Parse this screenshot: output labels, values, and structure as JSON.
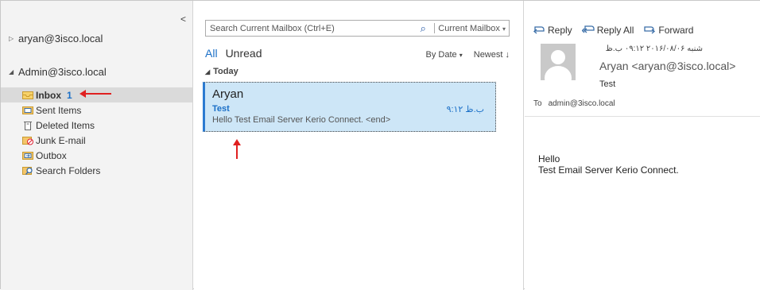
{
  "folder_pane": {
    "collapse_glyph": "<",
    "accounts": [
      {
        "name": "aryan@3isco.local",
        "expanded": false
      },
      {
        "name": "Admin@3isco.local",
        "expanded": true
      }
    ],
    "folders": [
      {
        "label": "Inbox",
        "count": "1",
        "icon": "inbox-icon",
        "selected": true
      },
      {
        "label": "Sent Items",
        "count": "",
        "icon": "sent-items-icon",
        "selected": false
      },
      {
        "label": "Deleted Items",
        "count": "",
        "icon": "trash-icon",
        "selected": false
      },
      {
        "label": "Junk E-mail",
        "count": "",
        "icon": "junk-mail-icon",
        "selected": false
      },
      {
        "label": "Outbox",
        "count": "",
        "icon": "outbox-icon",
        "selected": false
      },
      {
        "label": "Search Folders",
        "count": "",
        "icon": "search-folder-icon",
        "selected": false
      }
    ]
  },
  "message_list": {
    "search": {
      "placeholder": "Search Current Mailbox (Ctrl+E)",
      "scope": "Current Mailbox"
    },
    "filters": {
      "all": "All",
      "unread": "Unread",
      "sort_by": "By Date",
      "order": "Newest"
    },
    "group_label": "Today",
    "messages": [
      {
        "from": "Aryan",
        "subject": "Test",
        "time": "۹:۱۲ ب.ظ",
        "preview": "Hello  Test Email Server Kerio Connect. <end>"
      }
    ]
  },
  "reading_pane": {
    "actions": {
      "reply": "Reply",
      "reply_all": "Reply All",
      "forward": "Forward"
    },
    "date": "شنبه ۲۰۱۶/۰۸/۰۶ ۰۹:۱۲ ب.ظ",
    "sender": "Aryan <aryan@3isco.local>",
    "subject": "Test",
    "to_label": "To",
    "to_value": "admin@3isco.local",
    "body_lines": [
      "Hello",
      "Test Email Server Kerio Connect."
    ]
  },
  "colors": {
    "accent": "#1a6fc7",
    "selection": "#cde6f7",
    "annotation_red": "#e02020"
  }
}
